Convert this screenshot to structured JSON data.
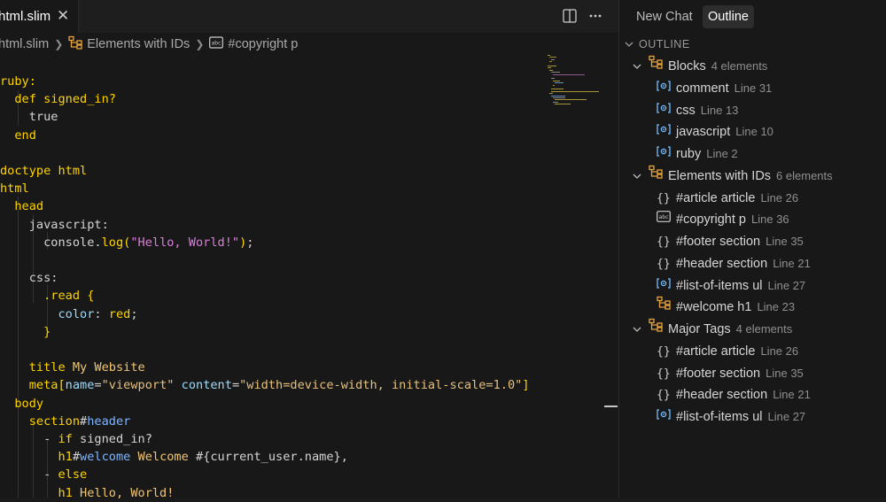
{
  "tab": {
    "title": "html.slim",
    "close": "✕"
  },
  "breadcrumb": {
    "file": "html.slim",
    "group": "Elements with IDs",
    "symbol": "#copyright p"
  },
  "code": [
    [
      [
        "tk-kw",
        "ruby:"
      ]
    ],
    [
      [
        "tk-kw",
        "  def "
      ],
      [
        "tk-tag",
        "signed_in?"
      ]
    ],
    [
      [
        "tk-plain",
        "    true"
      ]
    ],
    [
      [
        "tk-kw",
        "  end"
      ]
    ],
    [],
    [
      [
        "tk-kw",
        "doctype html"
      ]
    ],
    [
      [
        "tk-tag",
        "html"
      ]
    ],
    [
      [
        "tk-tag",
        "  head"
      ]
    ],
    [
      [
        "tk-plain",
        "    javascript:"
      ]
    ],
    [
      [
        "tk-plain",
        "      console."
      ],
      [
        "tk-tag",
        "log"
      ],
      [
        "tk-brk",
        "("
      ],
      [
        "tk-pink",
        "\"Hello, World!\""
      ],
      [
        "tk-brk",
        ")"
      ],
      [
        "tk-plain",
        ";"
      ]
    ],
    [],
    [
      [
        "tk-plain",
        "    css:"
      ]
    ],
    [
      [
        "tk-tag",
        "      .read "
      ],
      [
        "tk-brk",
        "{"
      ]
    ],
    [
      [
        "tk-attr",
        "        color"
      ],
      [
        "tk-plain",
        ": "
      ],
      [
        "tk-tag",
        "red"
      ],
      [
        "tk-plain",
        ";"
      ]
    ],
    [
      [
        "tk-brk",
        "      }"
      ]
    ],
    [],
    [
      [
        "tk-tag",
        "    title "
      ],
      [
        "tk-str2",
        "My Website"
      ]
    ],
    [
      [
        "tk-tag",
        "    meta"
      ],
      [
        "tk-brk",
        "["
      ],
      [
        "tk-attr",
        "name"
      ],
      [
        "tk-plain",
        "="
      ],
      [
        "tk-str",
        "\"viewport\""
      ],
      [
        "tk-plain",
        " "
      ],
      [
        "tk-attr",
        "content"
      ],
      [
        "tk-plain",
        "="
      ],
      [
        "tk-str",
        "\"width=device-width, initial-scale=1.0\""
      ],
      [
        "tk-brk",
        "]"
      ]
    ],
    [
      [
        "tk-tag",
        "  body"
      ]
    ],
    [
      [
        "tk-tag",
        "    section"
      ],
      [
        "tk-plain",
        "#"
      ],
      [
        "tk-blue",
        "header"
      ]
    ],
    [
      [
        "tk-dash",
        "      - "
      ],
      [
        "tk-kw",
        "if "
      ],
      [
        "tk-plain",
        "signed_in?"
      ]
    ],
    [
      [
        "tk-tag",
        "        h1"
      ],
      [
        "tk-plain",
        "#"
      ],
      [
        "tk-blue",
        "welcome "
      ],
      [
        "tk-str2",
        "Welcome "
      ],
      [
        "tk-plain",
        "#{current_user.name}"
      ],
      [
        "tk-plain",
        ","
      ]
    ],
    [
      [
        "tk-dash",
        "      - "
      ],
      [
        "tk-kw",
        "else"
      ]
    ],
    [
      [
        "tk-tag",
        "        h1 "
      ],
      [
        "tk-str2",
        "Hello, World!"
      ]
    ]
  ],
  "panel": {
    "tabs": [
      "New Chat",
      "Outline"
    ],
    "outline_title": "OUTLINE",
    "groups": [
      {
        "name": "Blocks",
        "detail": "4 elements",
        "items": [
          {
            "icon": "symbol-icon",
            "name": "comment",
            "detail": "Line 31"
          },
          {
            "icon": "symbol-icon",
            "name": "css",
            "detail": "Line 13"
          },
          {
            "icon": "symbol-icon",
            "name": "javascript",
            "detail": "Line 10"
          },
          {
            "icon": "symbol-icon",
            "name": "ruby",
            "detail": "Line 2"
          }
        ]
      },
      {
        "name": "Elements with IDs",
        "detail": "6 elements",
        "items": [
          {
            "icon": "braces-icon",
            "name": "#article article",
            "detail": "Line 26"
          },
          {
            "icon": "text-icon",
            "name": "#copyright p",
            "detail": "Line 36"
          },
          {
            "icon": "braces-icon",
            "name": "#footer section",
            "detail": "Line 35"
          },
          {
            "icon": "braces-icon",
            "name": "#header section",
            "detail": "Line 21"
          },
          {
            "icon": "symbol-icon",
            "name": "#list-of-items ul",
            "detail": "Line 27"
          },
          {
            "icon": "struct-icon",
            "name": "#welcome h1",
            "detail": "Line 23"
          }
        ]
      },
      {
        "name": "Major Tags",
        "detail": "4 elements",
        "items": [
          {
            "icon": "braces-icon",
            "name": "#article article",
            "detail": "Line 26"
          },
          {
            "icon": "braces-icon",
            "name": "#footer section",
            "detail": "Line 35"
          },
          {
            "icon": "braces-icon",
            "name": "#header section",
            "detail": "Line 21"
          },
          {
            "icon": "symbol-icon",
            "name": "#list-of-items ul",
            "detail": "Line 27"
          }
        ]
      }
    ]
  },
  "colors": {
    "background": "#181818",
    "accent_orange": "#e8a33d",
    "accent_blue": "#75beff",
    "keyword_yellow": "#ffd400"
  }
}
